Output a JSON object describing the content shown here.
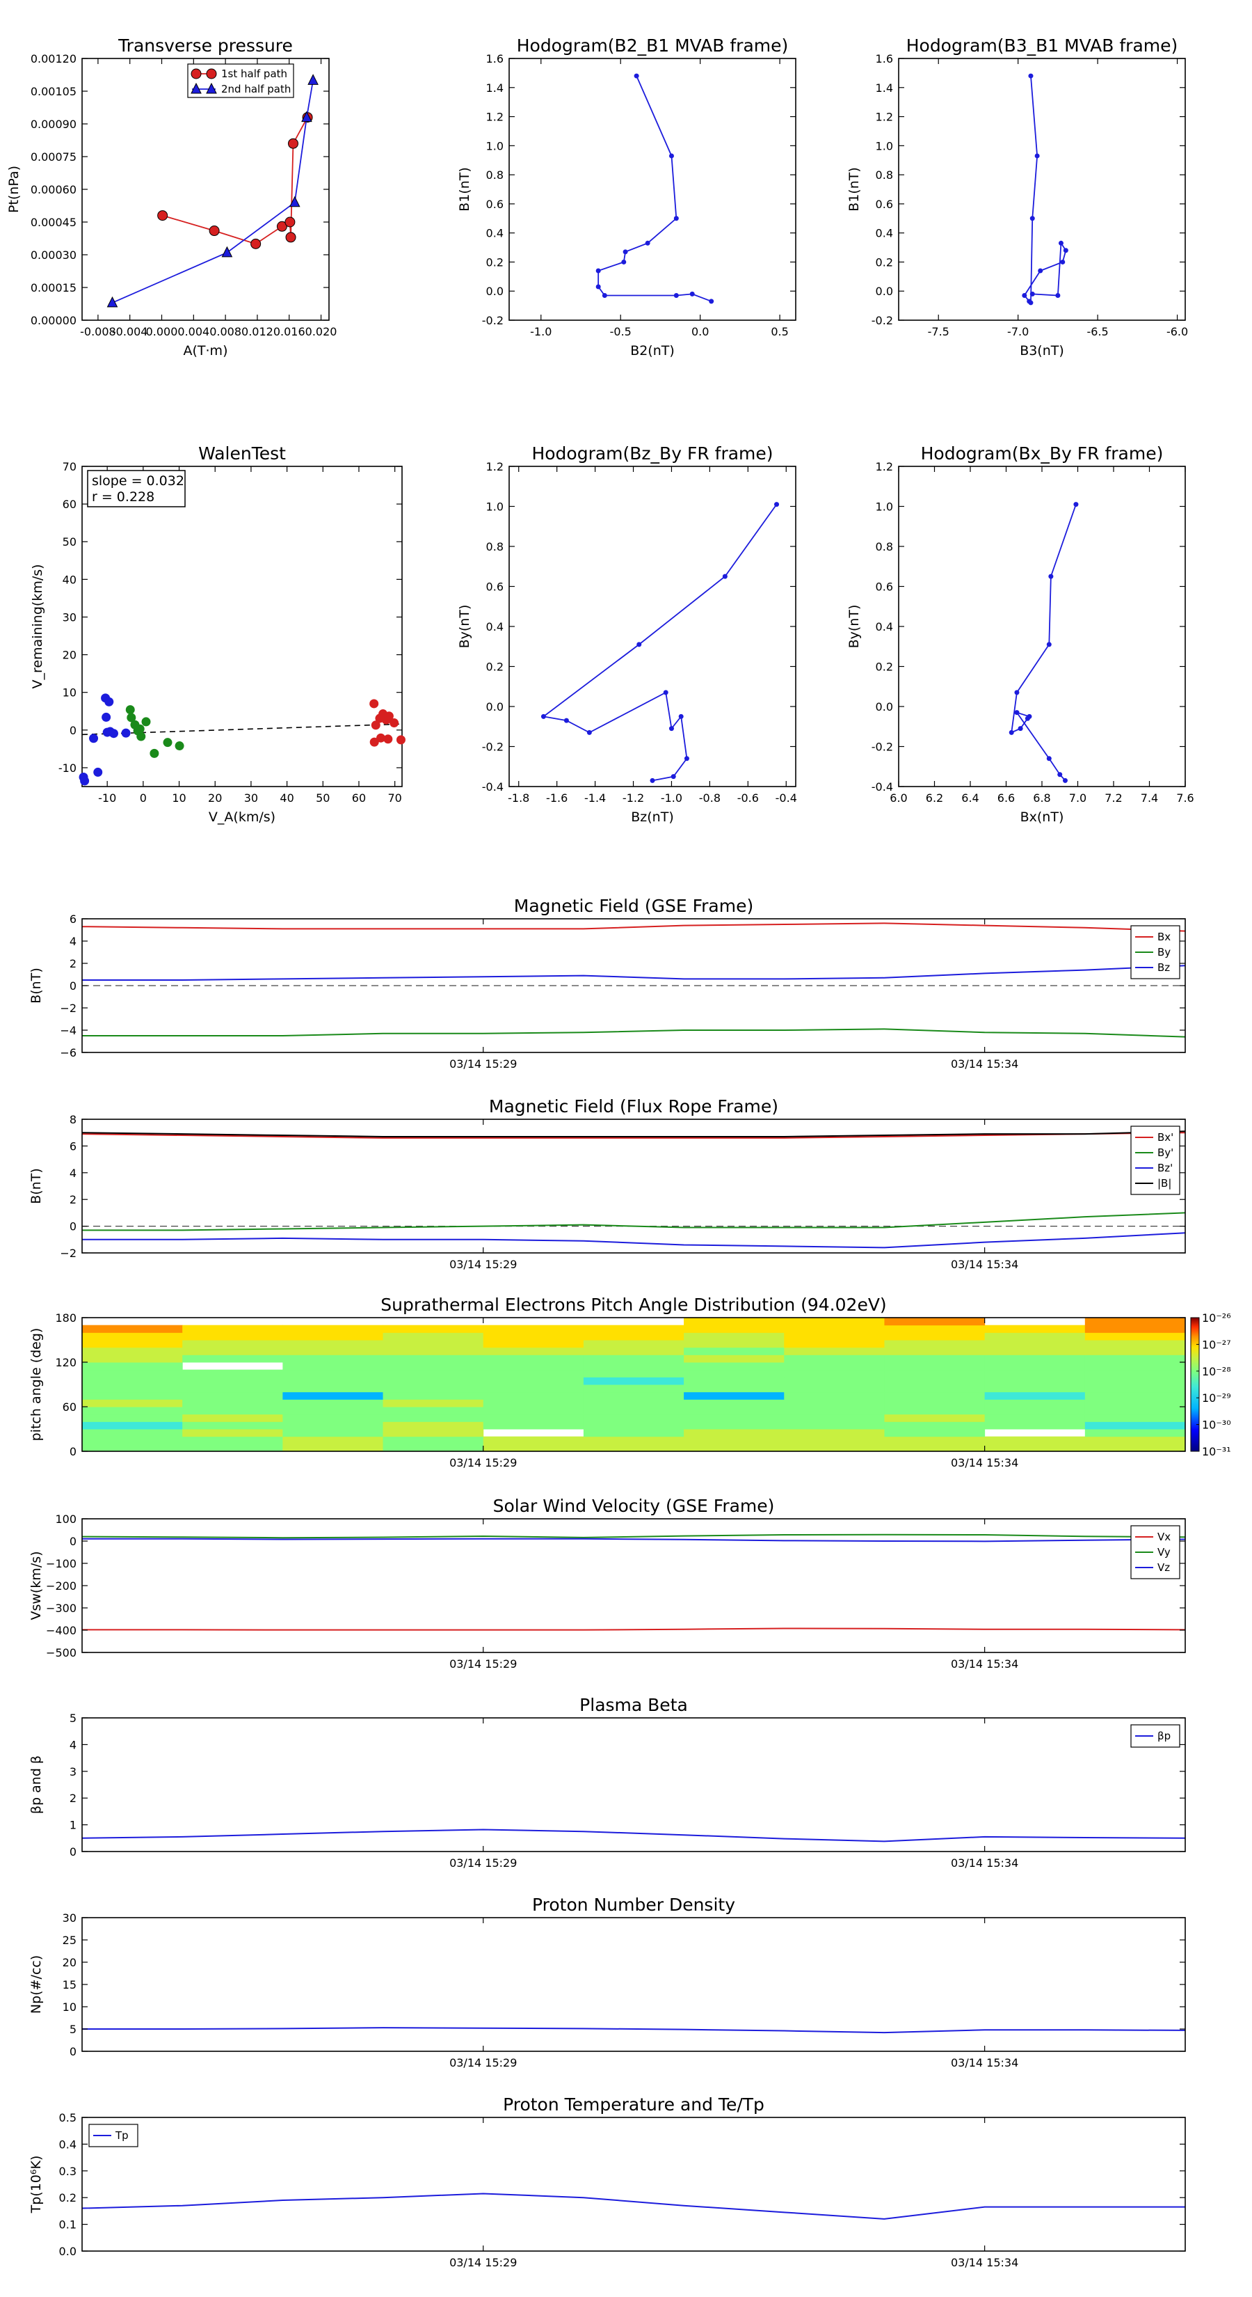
{
  "colors": {
    "red": "#d62020",
    "green": "#1a8a1a",
    "blue": "#1c1cdc",
    "black": "#000000",
    "dash": "#444444"
  },
  "time_ticks": [
    "03/14 15:29",
    "03/14 15:34"
  ],
  "chart_data": [
    {
      "id": "transverse-pressure",
      "type": "line",
      "title": "Transverse pressure",
      "xlabel": "A(T·m)",
      "ylabel": "Pt(nPa)",
      "xlim": [
        -0.01,
        0.021
      ],
      "ylim": [
        0,
        0.0012
      ],
      "xticks": [
        "-0.008",
        "-0.004",
        "0.000",
        "0.004",
        "0.008",
        "0.012",
        "0.016",
        "0.020"
      ],
      "yticks": [
        "0.00000",
        "0.00015",
        "0.00030",
        "0.00045",
        "0.00060",
        "0.00075",
        "0.00090",
        "0.00105",
        "0.00120"
      ],
      "legend": [
        "1st half path",
        "2nd half path"
      ],
      "series": [
        {
          "name": "1st half path",
          "color": "red",
          "marker": "circle",
          "x": [
            0.0001,
            0.0066,
            0.0118,
            0.0151,
            0.0161,
            0.0162,
            0.0165,
            0.0183
          ],
          "y": [
            0.00048,
            0.00041,
            0.00035,
            0.00043,
            0.00045,
            0.00038,
            0.00081,
            0.00093
          ]
        },
        {
          "name": "2nd half path",
          "color": "blue",
          "marker": "triangle",
          "x": [
            -0.0062,
            0.0082,
            0.0167,
            0.0182,
            0.019
          ],
          "y": [
            8e-05,
            0.00031,
            0.00054,
            0.00093,
            0.0011
          ]
        }
      ]
    },
    {
      "id": "hodogram-b2-b1",
      "type": "line",
      "title": "Hodogram(B2_B1 MVAB frame)",
      "xlabel": "B2(nT)",
      "ylabel": "B1(nT)",
      "xlim": [
        -1.2,
        0.6
      ],
      "ylim": [
        -0.2,
        1.6
      ],
      "xticks": [
        "-1.0",
        "-0.5",
        "0.0",
        "0.5"
      ],
      "yticks": [
        "-0.2",
        "0.0",
        "0.2",
        "0.4",
        "0.6",
        "0.8",
        "1.0",
        "1.2",
        "1.4",
        "1.6"
      ],
      "series": [
        {
          "color": "blue",
          "marker": "dot",
          "x": [
            -0.4,
            -0.18,
            -0.15,
            -0.33,
            -0.47,
            -0.48,
            -0.64,
            -0.64,
            -0.6,
            -0.15,
            -0.05,
            0.07
          ],
          "y": [
            1.48,
            0.93,
            0.5,
            0.33,
            0.27,
            0.2,
            0.14,
            0.03,
            -0.03,
            -0.03,
            -0.02,
            -0.07
          ]
        }
      ]
    },
    {
      "id": "hodogram-b3-b1",
      "type": "line",
      "title": "Hodogram(B3_B1 MVAB frame)",
      "xlabel": "B3(nT)",
      "ylabel": "B1(nT)",
      "xlim": [
        -7.75,
        -5.95
      ],
      "ylim": [
        -0.2,
        1.6
      ],
      "xticks": [
        "-7.5",
        "-7.0",
        "-6.5",
        "-6.0"
      ],
      "yticks": [
        "-0.2",
        "0.0",
        "0.2",
        "0.4",
        "0.6",
        "0.8",
        "1.0",
        "1.2",
        "1.4",
        "1.6"
      ],
      "series": [
        {
          "color": "blue",
          "marker": "dot",
          "x": [
            -6.92,
            -6.88,
            -6.91,
            -6.92,
            -6.93,
            -6.96,
            -6.86,
            -6.72,
            -6.7,
            -6.73,
            -6.75,
            -6.91
          ],
          "y": [
            1.48,
            0.93,
            0.5,
            -0.08,
            -0.07,
            -0.03,
            0.14,
            0.2,
            0.28,
            0.33,
            -0.03,
            -0.02
          ]
        }
      ]
    },
    {
      "id": "walen-test",
      "type": "scatter",
      "title": "WalenTest",
      "xlabel": "V_A(km/s)",
      "ylabel": "V_remaining(km/s)",
      "xlim": [
        -17,
        72
      ],
      "ylim": [
        -15,
        70
      ],
      "xticks": [
        "-10",
        "0",
        "10",
        "20",
        "30",
        "40",
        "50",
        "60",
        "70"
      ],
      "yticks": [
        "-10",
        "0",
        "10",
        "20",
        "30",
        "40",
        "50",
        "60",
        "70"
      ],
      "annotation": [
        "slope = 0.032",
        "r = 0.228"
      ],
      "fit_line": {
        "x": [
          -17,
          72
        ],
        "y": [
          -1.2,
          1.6
        ]
      },
      "series": [
        {
          "color": "blue",
          "x": [
            -10.5,
            -9.5,
            -10.3,
            -9.2,
            -10,
            -8.2,
            -4.8,
            -13.8,
            -16.6,
            -16.3,
            -12.6
          ],
          "y": [
            8.5,
            7.5,
            3.4,
            -0.4,
            -0.6,
            -0.9,
            -0.8,
            -2.2,
            -12.5,
            -13.5,
            -11.2
          ]
        },
        {
          "color": "green",
          "x": [
            -3.6,
            -3.3,
            -2.3,
            -1.5,
            -0.9,
            -0.6,
            0.8,
            3.1,
            6.8,
            10.1
          ],
          "y": [
            5.4,
            3.3,
            1.4,
            -0.2,
            0.3,
            -1.7,
            2.2,
            -6.2,
            -3.3,
            -4.2
          ]
        },
        {
          "color": "red",
          "x": [
            64.2,
            64.7,
            65.8,
            66.7,
            67.6,
            68.4,
            68.1,
            69.8,
            71.7,
            64.3,
            66.1
          ],
          "y": [
            7,
            1.3,
            3.1,
            4.3,
            2.7,
            3.7,
            -2.4,
            1.9,
            -2.6,
            -3.2,
            -2.1
          ]
        }
      ]
    },
    {
      "id": "hodogram-bz-by",
      "type": "line",
      "title": "Hodogram(Bz_By FR frame)",
      "xlabel": "Bz(nT)",
      "ylabel": "By(nT)",
      "xlim": [
        -1.85,
        -0.35
      ],
      "ylim": [
        -0.4,
        1.2
      ],
      "xticks": [
        "-1.8",
        "-1.6",
        "-1.4",
        "-1.2",
        "-1.0",
        "-0.8",
        "-0.6",
        "-0.4"
      ],
      "yticks": [
        "-0.4",
        "-0.2",
        "0.0",
        "0.2",
        "0.4",
        "0.6",
        "0.8",
        "1.0",
        "1.2"
      ],
      "series": [
        {
          "color": "blue",
          "marker": "dot",
          "x": [
            -0.45,
            -0.72,
            -1.17,
            -1.67,
            -1.55,
            -1.43,
            -1.03,
            -1.0,
            -0.95,
            -0.92,
            -0.99,
            -1.1
          ],
          "y": [
            1.01,
            0.65,
            0.31,
            -0.05,
            -0.07,
            -0.13,
            0.07,
            -0.11,
            -0.05,
            -0.26,
            -0.35,
            -0.37
          ]
        }
      ]
    },
    {
      "id": "hodogram-bx-by",
      "type": "line",
      "title": "Hodogram(Bx_By FR frame)",
      "xlabel": "Bx(nT)",
      "ylabel": "By(nT)",
      "xlim": [
        6.0,
        7.6
      ],
      "ylim": [
        -0.4,
        1.2
      ],
      "xticks": [
        "6.0",
        "6.2",
        "6.4",
        "6.6",
        "6.8",
        "7.0",
        "7.2",
        "7.4",
        "7.6"
      ],
      "yticks": [
        "-0.4",
        "-0.2",
        "0.0",
        "0.2",
        "0.4",
        "0.6",
        "0.8",
        "1.0",
        "1.2"
      ],
      "series": [
        {
          "color": "blue",
          "marker": "dot",
          "x": [
            6.99,
            6.85,
            6.84,
            6.66,
            6.63,
            6.68,
            6.72,
            6.73,
            6.66,
            6.84,
            6.9,
            6.93
          ],
          "y": [
            1.01,
            0.65,
            0.31,
            0.07,
            -0.13,
            -0.11,
            -0.06,
            -0.05,
            -0.03,
            -0.26,
            -0.34,
            -0.37
          ]
        }
      ]
    },
    {
      "id": "mag-gse",
      "type": "line",
      "title": "Magnetic Field (GSE Frame)",
      "ylabel": "B(nT)",
      "ylim": [
        -6,
        6
      ],
      "yticks": [
        "−6",
        "−4",
        "−2",
        "0",
        "2",
        "4",
        "6"
      ],
      "zero_line": true,
      "legend": [
        "Bx",
        "By",
        "Bz"
      ],
      "x": [
        0,
        1,
        2,
        3,
        4,
        5,
        6,
        7,
        8,
        9,
        10,
        11
      ],
      "series": [
        {
          "name": "Bx",
          "color": "red",
          "values": [
            5.3,
            5.2,
            5.1,
            5.1,
            5.1,
            5.1,
            5.4,
            5.5,
            5.6,
            5.4,
            5.2,
            4.9
          ]
        },
        {
          "name": "By",
          "color": "green",
          "values": [
            -4.5,
            -4.5,
            -4.5,
            -4.3,
            -4.3,
            -4.2,
            -4.0,
            -4.0,
            -3.9,
            -4.2,
            -4.3,
            -4.6
          ]
        },
        {
          "name": "Bz",
          "color": "blue",
          "values": [
            0.5,
            0.5,
            0.6,
            0.7,
            0.8,
            0.9,
            0.6,
            0.6,
            0.7,
            1.1,
            1.4,
            1.8
          ]
        }
      ]
    },
    {
      "id": "mag-fr",
      "type": "line",
      "title": "Magnetic Field (Flux Rope Frame)",
      "ylabel": "B(nT)",
      "ylim": [
        -2,
        8
      ],
      "yticks": [
        "−2",
        "0",
        "2",
        "4",
        "6",
        "8"
      ],
      "zero_line": true,
      "legend": [
        "Bx'",
        "By'",
        "Bz'",
        "|B|"
      ],
      "x": [
        0,
        1,
        2,
        3,
        4,
        5,
        6,
        7,
        8,
        9,
        10,
        11
      ],
      "series": [
        {
          "name": "Bx'",
          "color": "red",
          "values": [
            6.9,
            6.8,
            6.7,
            6.6,
            6.6,
            6.6,
            6.6,
            6.6,
            6.7,
            6.8,
            6.9,
            7.0
          ]
        },
        {
          "name": "By'",
          "color": "green",
          "values": [
            -0.3,
            -0.3,
            -0.2,
            -0.1,
            0.0,
            0.1,
            -0.1,
            -0.1,
            -0.1,
            0.3,
            0.7,
            1.0
          ]
        },
        {
          "name": "Bz'",
          "color": "blue",
          "values": [
            -1.0,
            -1.0,
            -0.9,
            -1.0,
            -1.0,
            -1.1,
            -1.4,
            -1.5,
            -1.6,
            -1.2,
            -0.9,
            -0.5
          ]
        },
        {
          "name": "|B|",
          "color": "black",
          "values": [
            7.0,
            6.9,
            6.8,
            6.7,
            6.7,
            6.7,
            6.7,
            6.7,
            6.8,
            6.9,
            6.9,
            7.1
          ]
        }
      ]
    },
    {
      "id": "pad",
      "type": "heatmap",
      "title": "Suprathermal Electrons Pitch Angle Distribution (94.02eV)",
      "ylabel": "pitch angle (deg)",
      "ylim": [
        0,
        180
      ],
      "yticks": [
        "0",
        "60",
        "120",
        "180"
      ],
      "colorbar_ticks": [
        "10⁻²⁶",
        "10⁻²⁷",
        "10⁻²⁸",
        "10⁻²⁹",
        "10⁻³⁰",
        "10⁻³¹"
      ],
      "levels_note": "values are colorbar levels 0 (10^-31) to 5 (10^-26); null = blank",
      "columns": 11,
      "rows": 18,
      "z": [
        [
          3.2,
          3.3,
          3.4,
          3.3,
          3.5,
          3.6,
          3.4,
          3.6,
          3.5,
          3.6,
          3.5
        ],
        [
          3.3,
          3.2,
          3.5,
          3.2,
          3.4,
          3.5,
          3.6,
          3.4,
          3.4,
          3.5,
          3.6
        ],
        [
          3.0,
          3.4,
          3.3,
          3.4,
          null,
          3.2,
          3.4,
          3.5,
          3.3,
          null,
          3.2
        ],
        [
          2.7,
          3.1,
          3.2,
          3.4,
          3.3,
          3.3,
          3.2,
          3.3,
          3.2,
          3.1,
          2.8
        ],
        [
          3.3,
          3.5,
          3.0,
          3.2,
          3.3,
          3.1,
          3.3,
          3.2,
          3.4,
          3.2,
          3.1
        ],
        [
          3.1,
          3.3,
          3.2,
          3.0,
          3.2,
          3.0,
          3.0,
          3.1,
          3.2,
          3.1,
          3.2
        ],
        [
          3.4,
          3.2,
          3.3,
          3.4,
          3.3,
          3.3,
          3.2,
          3.3,
          3.1,
          3.3,
          3.0
        ],
        [
          3.2,
          3.1,
          2.0,
          3.2,
          3.1,
          3.2,
          2.2,
          3.2,
          3.2,
          2.9,
          3.3
        ],
        [
          3.1,
          3.2,
          3.1,
          3.3,
          3.2,
          3.1,
          3.3,
          3.1,
          3.0,
          3.2,
          3.1
        ],
        [
          3.3,
          3.0,
          3.2,
          3.1,
          3.0,
          2.7,
          3.1,
          3.2,
          3.3,
          3.1,
          3.0
        ],
        [
          3.0,
          3.3,
          3.0,
          3.2,
          3.3,
          3.1,
          3.2,
          3.0,
          3.1,
          3.3,
          3.3
        ],
        [
          3.2,
          null,
          3.3,
          3.0,
          3.2,
          3.3,
          3.0,
          3.3,
          3.2,
          3.0,
          3.1
        ],
        [
          3.5,
          3.2,
          3.2,
          3.3,
          3.1,
          3.2,
          3.4,
          3.2,
          3.3,
          3.2,
          3.2
        ],
        [
          3.6,
          3.4,
          3.5,
          3.5,
          3.4,
          3.6,
          3.3,
          3.5,
          3.4,
          3.5,
          3.4
        ],
        [
          3.8,
          3.7,
          3.6,
          3.7,
          3.8,
          3.7,
          3.5,
          3.8,
          3.6,
          3.7,
          3.6
        ],
        [
          4.1,
          4.0,
          3.9,
          3.7,
          3.9,
          3.8,
          3.7,
          4.0,
          3.8,
          3.7,
          3.9
        ],
        [
          4.2,
          4.1,
          4.0,
          3.9,
          4.0,
          3.9,
          3.8,
          4.1,
          3.9,
          3.8,
          4.2
        ],
        [
          null,
          null,
          null,
          null,
          null,
          null,
          3.8,
          4.0,
          4.4,
          null,
          4.2
        ]
      ]
    },
    {
      "id": "sw-velocity",
      "type": "line",
      "title": "Solar Wind Velocity (GSE Frame)",
      "ylabel": "Vsw(km/s)",
      "ylim": [
        -500,
        100
      ],
      "yticks": [
        "−500",
        "−400",
        "−300",
        "−200",
        "−100",
        "0",
        "100"
      ],
      "legend": [
        "Vx",
        "Vy",
        "Vz"
      ],
      "x": [
        0,
        1,
        2,
        3,
        4,
        5,
        6,
        7,
        8,
        9,
        10,
        11
      ],
      "series": [
        {
          "name": "Vx",
          "color": "red",
          "values": [
            -398,
            -398,
            -399,
            -399,
            -399,
            -399,
            -396,
            -392,
            -393,
            -396,
            -396,
            -398
          ]
        },
        {
          "name": "Vy",
          "color": "green",
          "values": [
            20,
            18,
            15,
            17,
            22,
            16,
            23,
            28,
            29,
            28,
            21,
            18
          ]
        },
        {
          "name": "Vz",
          "color": "blue",
          "values": [
            10,
            10,
            8,
            9,
            10,
            10,
            7,
            2,
            0,
            -1,
            4,
            8
          ]
        }
      ]
    },
    {
      "id": "plasma-beta",
      "type": "line",
      "title": "Plasma Beta",
      "ylabel": "βp and β",
      "ylim": [
        0,
        5
      ],
      "yticks": [
        "0",
        "1",
        "2",
        "3",
        "4",
        "5"
      ],
      "legend": [
        "βp"
      ],
      "x": [
        0,
        1,
        2,
        3,
        4,
        5,
        6,
        7,
        8,
        9,
        10,
        11
      ],
      "series": [
        {
          "name": "βp",
          "color": "blue",
          "values": [
            0.5,
            0.55,
            0.65,
            0.75,
            0.82,
            0.75,
            0.62,
            0.48,
            0.38,
            0.55,
            0.52,
            0.5
          ]
        }
      ]
    },
    {
      "id": "proton-density",
      "type": "line",
      "title": "Proton Number Density",
      "ylabel": "Np(#/cc)",
      "ylim": [
        0,
        30
      ],
      "yticks": [
        "0",
        "5",
        "10",
        "15",
        "20",
        "25",
        "30"
      ],
      "x": [
        0,
        1,
        2,
        3,
        4,
        5,
        6,
        7,
        8,
        9,
        10,
        11
      ],
      "series": [
        {
          "name": "Np",
          "color": "blue",
          "values": [
            5.0,
            5.0,
            5.1,
            5.3,
            5.2,
            5.1,
            4.9,
            4.6,
            4.2,
            4.8,
            4.8,
            4.7
          ]
        }
      ]
    },
    {
      "id": "proton-temp",
      "type": "line",
      "title": "Proton Temperature and Te/Tp",
      "ylabel": "Tp(10⁶K)",
      "ylim": [
        0,
        0.5
      ],
      "yticks": [
        "0.0",
        "0.1",
        "0.2",
        "0.3",
        "0.4",
        "0.5"
      ],
      "legend": [
        "Tp"
      ],
      "x": [
        0,
        1,
        2,
        3,
        4,
        5,
        6,
        7,
        8,
        9,
        10,
        11
      ],
      "series": [
        {
          "name": "Tp",
          "color": "blue",
          "values": [
            0.16,
            0.17,
            0.19,
            0.2,
            0.215,
            0.2,
            0.17,
            0.145,
            0.12,
            0.165,
            0.165,
            0.165
          ]
        }
      ]
    }
  ]
}
